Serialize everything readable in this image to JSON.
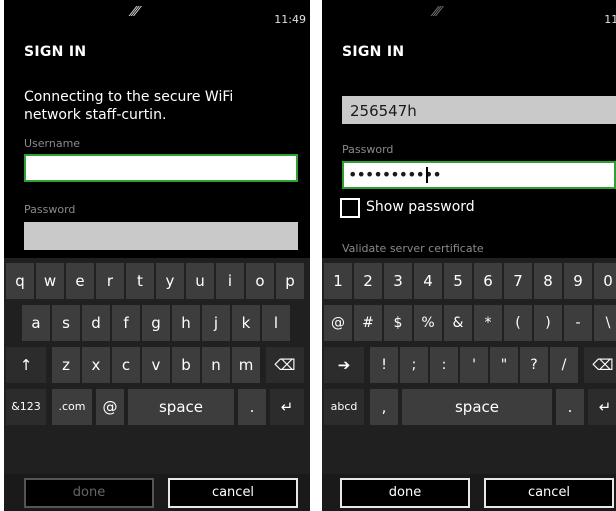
{
  "left": {
    "status": {
      "signal_icon": "wifi-signal-icon",
      "time": "11:49"
    },
    "title": "SIGN IN",
    "message": "Connecting to the secure WiFi network staff-curtin.",
    "username": {
      "label": "Username",
      "value": ""
    },
    "password": {
      "label": "Password",
      "value": ""
    },
    "keyboard": {
      "row1": [
        "q",
        "w",
        "e",
        "r",
        "t",
        "y",
        "u",
        "i",
        "o",
        "p"
      ],
      "row2": [
        "a",
        "s",
        "d",
        "f",
        "g",
        "h",
        "j",
        "k",
        "l"
      ],
      "row3": [
        "↑",
        "z",
        "x",
        "c",
        "v",
        "b",
        "n",
        "m",
        "⌫"
      ],
      "row4": {
        "sym": "&123",
        "dotcom": ".com",
        "at": "@",
        "space": "space",
        "period": ".",
        "enter": "↵"
      }
    },
    "buttons": {
      "done": "done",
      "cancel": "cancel"
    }
  },
  "right": {
    "status": {
      "signal_icon": "wifi-signal-icon",
      "time": "11:49"
    },
    "title": "SIGN IN",
    "username": {
      "value": "256547h"
    },
    "password": {
      "label": "Password",
      "value": "•••••••••••"
    },
    "show_password": {
      "label": "Show password",
      "checked": false
    },
    "validate_label": "Validate server certificate",
    "keyboard": {
      "row1": [
        "1",
        "2",
        "3",
        "4",
        "5",
        "6",
        "7",
        "8",
        "9",
        "0"
      ],
      "row2": [
        "@",
        "#",
        "$",
        "%",
        "&",
        "*",
        "(",
        ")",
        "-",
        "\\"
      ],
      "row3": [
        "➔",
        "!",
        ";",
        ":",
        "'",
        "\"",
        "?",
        "/",
        "⌫"
      ],
      "row4": {
        "abc": "abcd",
        "comma": ",",
        "space": "space",
        "period": ".",
        "enter": "↵"
      }
    },
    "buttons": {
      "done": "done",
      "cancel": "cancel"
    }
  }
}
